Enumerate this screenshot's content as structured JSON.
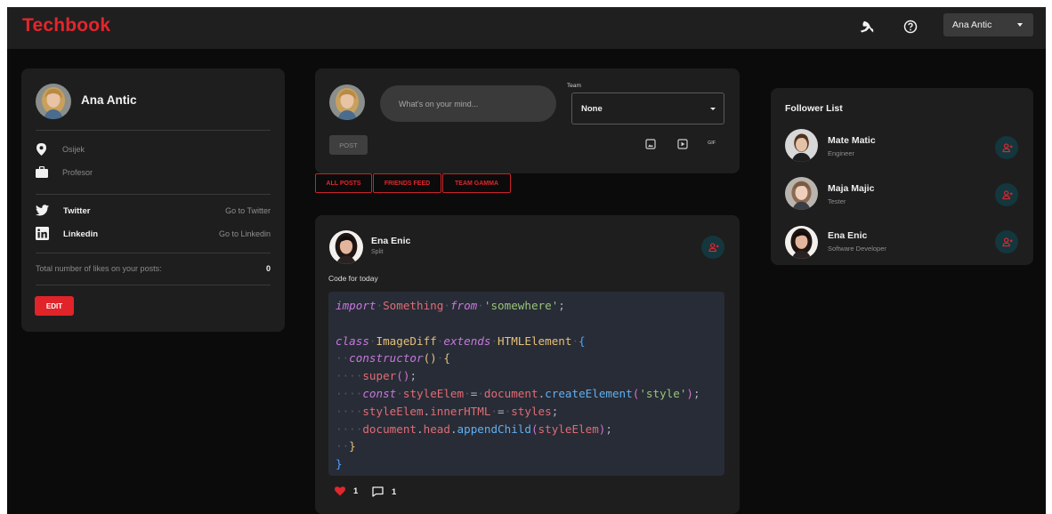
{
  "app": {
    "logo": "Techbook"
  },
  "navbar": {
    "user_label": "Ana Antic",
    "icons": [
      "theme-toggle-icon",
      "help-icon"
    ]
  },
  "profile": {
    "name": "Ana Antic",
    "location": "Osijek",
    "occupation": "Profesor",
    "socials": [
      {
        "network": "Twitter",
        "link": "Go to Twitter",
        "icon": "twitter-icon"
      },
      {
        "network": "Linkedin",
        "link": "Go to Linkedin",
        "icon": "linkedin-icon"
      }
    ],
    "likes_label": "Total number of likes on your posts:",
    "likes_count": "0",
    "edit_label": "EDIT"
  },
  "composer": {
    "placeholder": "What's on your mind...",
    "team_label": "Team",
    "team_value": "None",
    "post_label": "POST",
    "gif_label": "GIF"
  },
  "tabs": [
    "ALL POSTS",
    "FRIENDS FEED",
    "TEAM GAMMA"
  ],
  "post": {
    "author": "Ena Enic",
    "location": "Split",
    "text": "Code for today",
    "code_lines": [
      "import Something from 'somewhere';",
      "",
      "class ImageDiff extends HTMLElement {",
      "  constructor() {",
      "    super();",
      "    const styleElem = document.createElement('style');",
      "    styleElem.innerHTML = styles;",
      "    document.head.appendChild(styleElem);",
      "  }",
      "}"
    ],
    "likes": "1",
    "comments": "1"
  },
  "followers": {
    "title": "Follower List",
    "items": [
      {
        "name": "Mate Matic",
        "role": "Engineer"
      },
      {
        "name": "Maja Majic",
        "role": "Tester"
      },
      {
        "name": "Ena Enic",
        "role": "Software Developer"
      }
    ]
  },
  "colors": {
    "brand": "#e3262c",
    "background": "#0b0b0b",
    "card": "#1e1e1e",
    "follow_button": "#14363d"
  }
}
